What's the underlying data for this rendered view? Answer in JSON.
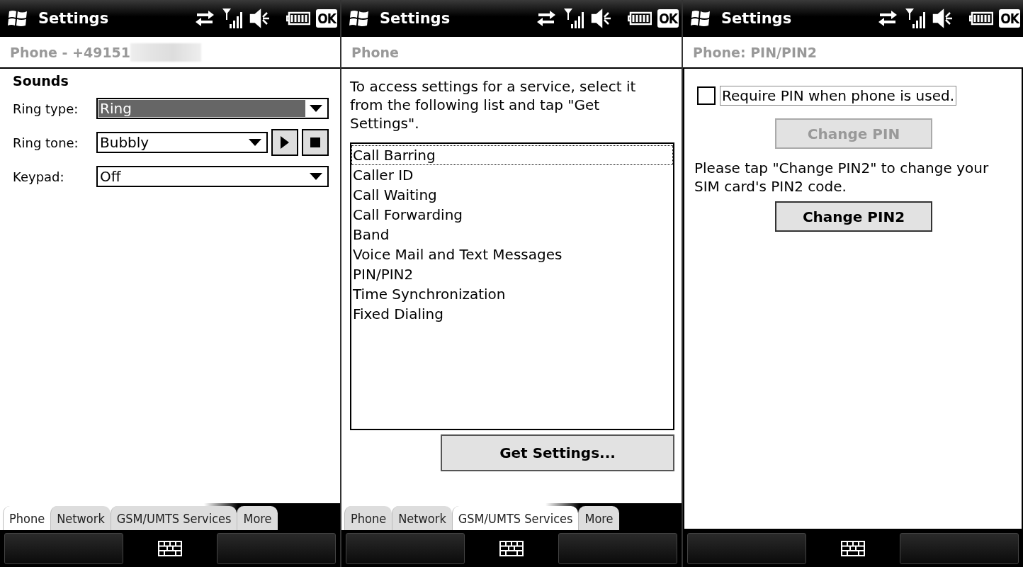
{
  "screens": [
    {
      "kind": "sounds",
      "title": "Settings",
      "ok": "OK",
      "header": "Phone - +49151",
      "redacted": true,
      "section": "Sounds",
      "fields": [
        {
          "label": "Ring type:",
          "value": "Ring",
          "focused": true,
          "player": false
        },
        {
          "label": "Ring tone:",
          "value": "Bubbly",
          "focused": false,
          "player": true
        },
        {
          "label": "Keypad:",
          "value": "Off",
          "focused": false,
          "player": false
        }
      ],
      "tabs": [
        {
          "label": "Phone",
          "selected": true
        },
        {
          "label": "Network",
          "selected": false
        },
        {
          "label": "GSM/UMTS Services",
          "selected": false
        },
        {
          "label": "More",
          "selected": false
        }
      ]
    },
    {
      "kind": "services",
      "title": "Settings",
      "ok": "OK",
      "header": "Phone",
      "intro": "To access settings for a service, select it from the following list and tap \"Get Settings\".",
      "items": [
        {
          "label": "Call Barring",
          "selected": true
        },
        {
          "label": "Caller ID",
          "selected": false
        },
        {
          "label": "Call Waiting",
          "selected": false
        },
        {
          "label": "Call Forwarding",
          "selected": false
        },
        {
          "label": "Band",
          "selected": false
        },
        {
          "label": "Voice Mail and Text Messages",
          "selected": false
        },
        {
          "label": "PIN/PIN2",
          "selected": false
        },
        {
          "label": "Time Synchronization",
          "selected": false
        },
        {
          "label": "Fixed Dialing",
          "selected": false
        }
      ],
      "button": "Get Settings...",
      "tabs": [
        {
          "label": "Phone",
          "selected": false
        },
        {
          "label": "Network",
          "selected": false
        },
        {
          "label": "GSM/UMTS Services",
          "selected": true
        },
        {
          "label": "More",
          "selected": false
        }
      ]
    },
    {
      "kind": "pin",
      "title": "Settings",
      "ok": "OK",
      "header": "Phone: PIN/PIN2",
      "checkbox": {
        "label": "Require PIN when phone is used.",
        "checked": false
      },
      "change_pin": {
        "label": "Change PIN",
        "disabled": true
      },
      "note": "Please tap \"Change PIN2\" to change your SIM card's PIN2 code.",
      "change_pin2": {
        "label": "Change PIN2",
        "disabled": false
      }
    }
  ]
}
